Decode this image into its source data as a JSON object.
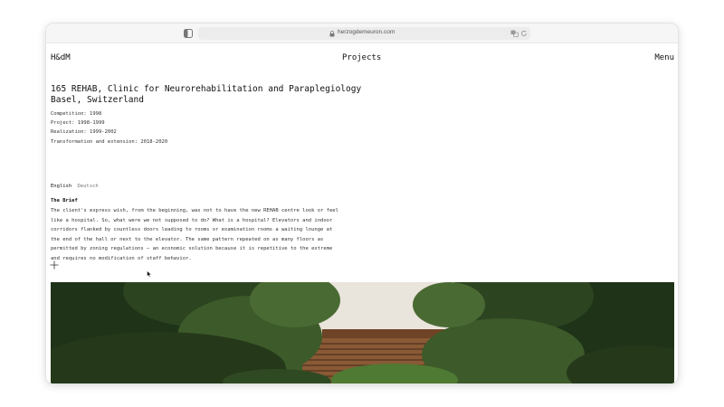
{
  "browser": {
    "url": "herzogdemeuron.com",
    "icons": [
      "sidebar-icon",
      "lock-icon",
      "translate-icon",
      "reload-icon"
    ]
  },
  "header": {
    "logo": "H&dM",
    "nav_projects": "Projects",
    "nav_menu": "Menu"
  },
  "project": {
    "title": "165 REHAB, Clinic for Neurorehabilitation and Paraplegiology",
    "location": "Basel, Switzerland",
    "meta": [
      "Competition: 1998",
      "Project: 1998-1999",
      "Realization: 1999-2002",
      "Transformation and extension: 2018-2020"
    ]
  },
  "languages": {
    "english": "English",
    "deutsch": "Deutsch"
  },
  "brief": {
    "heading": "The Brief",
    "text": "The client's express wish, from the beginning, was not to have the new REHAB centre look or feel like a hospital. So, what were we not supposed to do? What is a hospital? Elevators and indoor corridors flanked by countless doors leading to rooms or examination rooms a waiting lounge at the end of the hall or next to the elevator. The same pattern repeated on as many floors as permitted by zoning regulations – an economic solution because it is repetitive to the extreme and requires no modification of staff behavior."
  },
  "colors": {
    "text": "#111111",
    "muted": "#777777",
    "foliage_dark": "#1f3318",
    "foliage_mid": "#3d5a2a",
    "wood": "#8a5a36",
    "sky": "#e9e4dc"
  }
}
